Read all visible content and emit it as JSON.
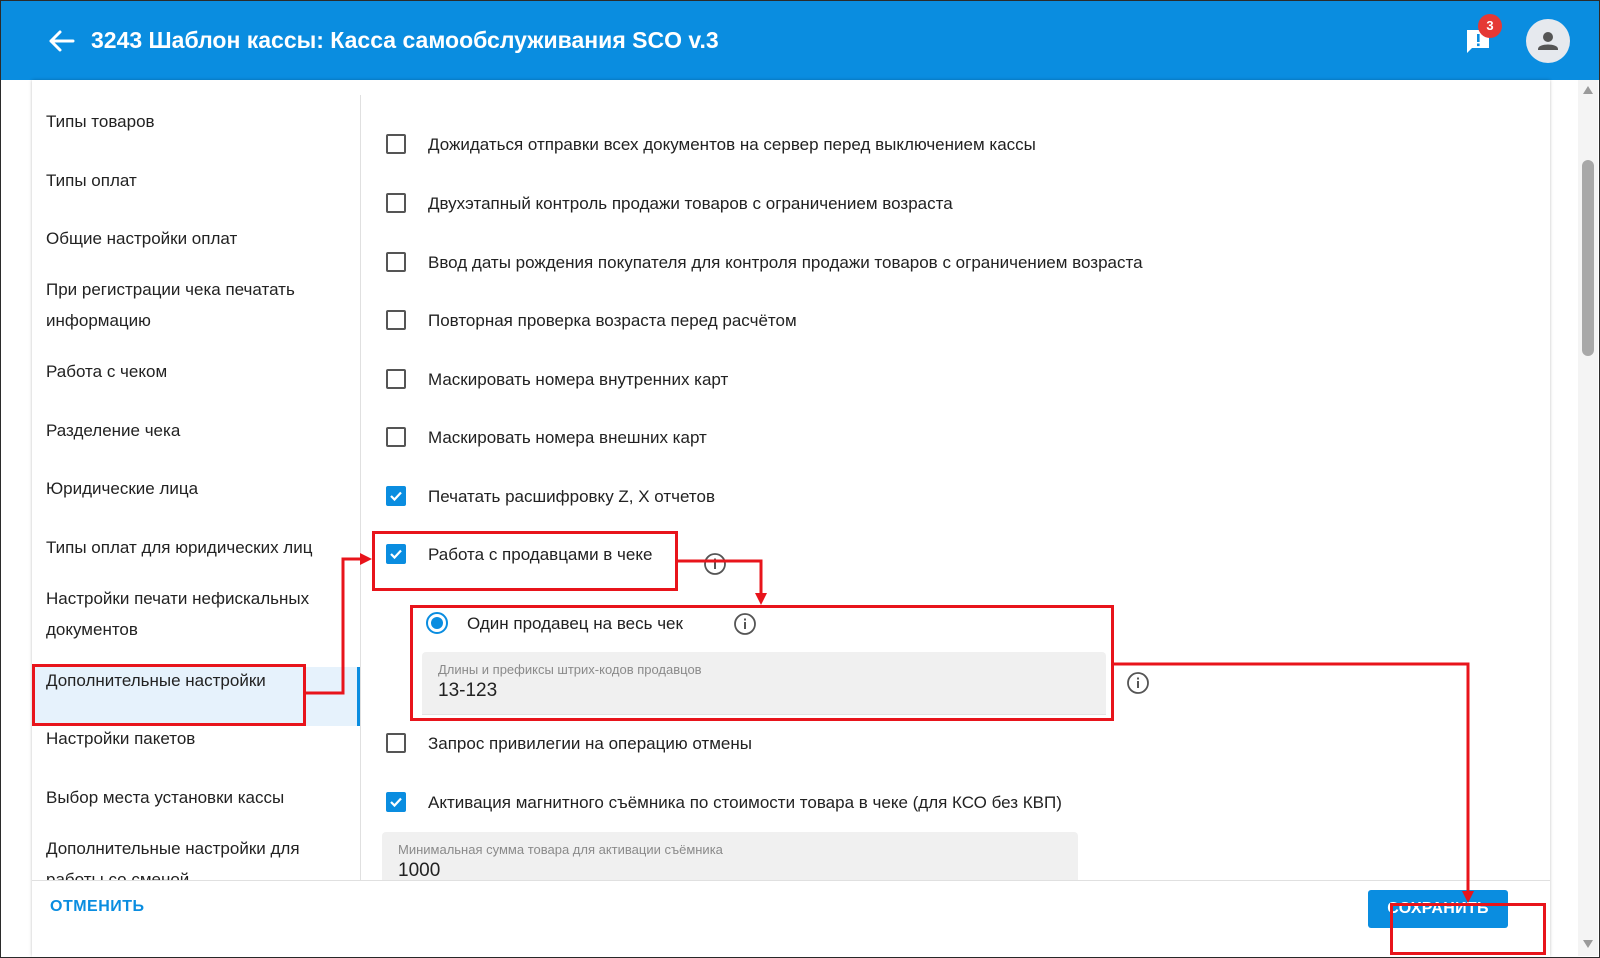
{
  "header": {
    "title": "3243 Шаблон кассы: Касса самообслуживания SCO v.3",
    "notification_count": "3"
  },
  "sidebar": {
    "items": [
      {
        "label": "Типы товаров"
      },
      {
        "label": "Типы оплат"
      },
      {
        "label": "Общие настройки оплат"
      },
      {
        "label": "При регистрации чека печатать информацию"
      },
      {
        "label": "Работа с чеком"
      },
      {
        "label": "Разделение чека"
      },
      {
        "label": "Юридические лица"
      },
      {
        "label": "Типы оплат для юридических лиц"
      },
      {
        "label": "Настройки печати нефискальных документов"
      },
      {
        "label": "Дополнительные настройки"
      },
      {
        "label": "Настройки пакетов"
      },
      {
        "label": "Выбор места установки кассы"
      },
      {
        "label": "Дополнительные настройки для работы со сменой"
      }
    ],
    "active_index": 9
  },
  "settings": {
    "items": [
      {
        "label": "Дожидаться отправки всех документов на сервер перед выключением кассы",
        "checked": false
      },
      {
        "label": "Двухэтапный контроль продажи товаров с ограничением возраста",
        "checked": false
      },
      {
        "label": "Ввод даты рождения покупателя для контроля продажи товаров с ограничением возраста",
        "checked": false
      },
      {
        "label": "Повторная проверка возраста перед расчётом",
        "checked": false
      },
      {
        "label": "Маскировать номера внутренних карт",
        "checked": false
      },
      {
        "label": "Маскировать номера внешних карт",
        "checked": false
      },
      {
        "label": "Печатать расшифровку Z, X отчетов",
        "checked": true
      },
      {
        "label": "Работа с продавцами в чеке",
        "checked": true
      },
      {
        "label": "Запрос привилегии на операцию отмены",
        "checked": false
      },
      {
        "label": "Активация магнитного съёмника по стоимости товара в чеке (для КСО без КВП)",
        "checked": true
      }
    ],
    "seller_mode": {
      "label": "Один продавец на весь чек",
      "selected": true
    },
    "barcode_field": {
      "label": "Длины и префиксы штрих-кодов продавцов",
      "value": "13-123"
    },
    "min_sum_field": {
      "label": "Минимальная сумма товара для активации съёмника",
      "value": "1000"
    }
  },
  "footer": {
    "cancel_label": "ОТМЕНИТЬ",
    "save_label": "СОХРАНИТЬ"
  },
  "colors": {
    "primary": "#0a8de0",
    "annotation": "#e8141b",
    "badge": "#e53935"
  }
}
